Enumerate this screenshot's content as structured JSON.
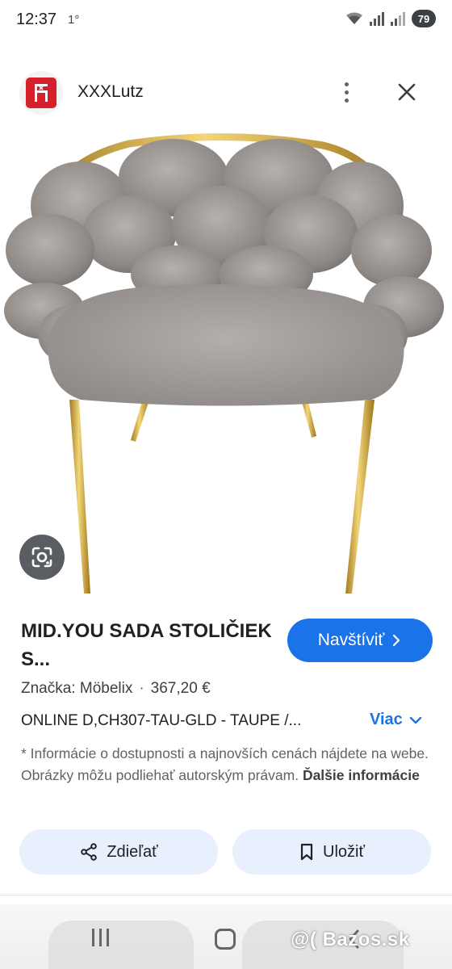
{
  "status_bar": {
    "time": "12:37",
    "temperature": "1°",
    "battery": "79",
    "icons": [
      "wifi-icon",
      "signal-icon",
      "signal-icon",
      "battery-icon"
    ]
  },
  "header": {
    "site_name": "XXXLutz",
    "logo_icon": "xxxlutz-chair-logo",
    "logo_color": "#d6202b",
    "menu_icon": "more-vert-icon",
    "close_icon": "close-icon"
  },
  "image": {
    "subject": "product-photo",
    "lens_icon": "google-lens-icon"
  },
  "product": {
    "title": "MID.YOU SADA STOLIČIEK S...",
    "visit_label": "Navštíviť",
    "brand_label": "Značka: Möbelix",
    "separator": "·",
    "price": "367,20 €",
    "description": "ONLINE D,CH307-TAU-GLD - TAUPE /...",
    "more_label": "Viac"
  },
  "disclaimer": {
    "text": "* Informácie o dostupnosti a najnovších cenách nájdete na webe. Obrázky môžu podliehať autorským právam.",
    "link_label": "Ďalšie informácie"
  },
  "actions": {
    "share_label": "Zdieľať",
    "save_label": "Uložiť"
  },
  "nav_bar": {
    "watermark": "@( Bazos.sk"
  },
  "colors": {
    "accent": "#1a73e8",
    "action_bg": "#e8f0fe",
    "brand_red": "#d6202b"
  }
}
